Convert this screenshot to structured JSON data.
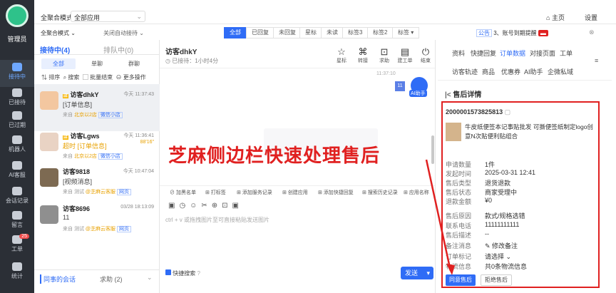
{
  "nav": {
    "user": "管理员",
    "items": [
      {
        "label": "接待中",
        "active": true
      },
      {
        "label": "已接待"
      },
      {
        "label": "已过期"
      },
      {
        "label": "机器人"
      },
      {
        "label": "AI客服"
      },
      {
        "label": "会话记录"
      },
      {
        "label": "留言"
      },
      {
        "label": "工单",
        "badge": "25"
      },
      {
        "label": "统计"
      }
    ]
  },
  "top": {
    "mode_label": "全聚合模式",
    "mode_value": "全部应用",
    "mode2": "全聚合模式",
    "auto": "关闭自动接待",
    "home": "主页",
    "settings": "设置",
    "filters": [
      "全部",
      "已回复",
      "未回复",
      "星标",
      "未读",
      "标签3",
      "标签2",
      "标签"
    ],
    "notice_tag": "公告",
    "notice": "3、账号到期提醒"
  },
  "list": {
    "tab_active": "接待中(4)",
    "tab_other": "排队中(0)",
    "subtabs": [
      "全部",
      "单聊",
      "群聊"
    ],
    "actions": [
      "排序",
      "搜索",
      "批量结束",
      "更多操作"
    ],
    "conversations": [
      {
        "name": "访客dhkY",
        "time": "今天 11:37:43",
        "msg": "[订单信息]",
        "src": "来自",
        "src_tag": "北京以2店",
        "app": "微信小店"
      },
      {
        "name": "访客Lgws",
        "time": "今天 11:36:41",
        "msg": "超时 [订单信息]",
        "src": "来自",
        "src_tag": "北京以2店",
        "app": "微信小店",
        "extra": "88'16\""
      },
      {
        "name": "访客9818",
        "time": "今天 10:47:04",
        "msg": "[视频消息]",
        "src": "来自 测试",
        "src_tag": "@芝麻云客服",
        "app": "网页"
      },
      {
        "name": "访客8696",
        "time": "03/28 18:13:09",
        "msg": "11",
        "src": "来自 测试",
        "src_tag": "@芝麻云客服",
        "app": "网页"
      }
    ],
    "footer_tab": "同事的会话",
    "footer_help": "求助 (2)"
  },
  "chat": {
    "title": "访客dhkY",
    "status": "已接待：1小时4分",
    "tools": [
      "星标",
      "转接",
      "求助",
      "建工单",
      "结束"
    ],
    "time_marker": "11:37:10",
    "ai_label": "AI助手",
    "bottom_tools": [
      "加黑名单",
      "打标签",
      "添加服务记录",
      "创建应用",
      "添加快捷回复",
      "搜索历史记录",
      "应用名称"
    ],
    "input_placeholder": "ctrl + v 或拖拽图片至可直接粘贴发送图片",
    "quick_search": "快捷搜索",
    "send": "发送"
  },
  "right": {
    "tabs_row1": [
      "资料",
      "快捷回复",
      "订单数据",
      "对接页面",
      "工单"
    ],
    "tabs_row2": [
      "访客轨迹",
      "商品",
      "优惠券",
      "AI助手",
      "企微私域"
    ],
    "section_title": "售后详情",
    "order_no": "2000001573825813",
    "product": "牛皮纸便签本记事贴批发 可撕便签纸制定logo创意N次贴便利贴组合",
    "fields": [
      {
        "label": "申请数量",
        "value": "1件"
      },
      {
        "label": "发起时间",
        "value": "2025-03-31 12:41"
      },
      {
        "label": "售后类型",
        "value": "退货退款"
      },
      {
        "label": "售后状态",
        "value": "商家受理中"
      },
      {
        "label": "退款金额",
        "value": "¥0"
      },
      {
        "label": "售后原因",
        "value": "款式/规格选错"
      },
      {
        "label": "联系电话",
        "value": "11111111111"
      },
      {
        "label": "售后描述",
        "value": "--"
      },
      {
        "label": "备注消息",
        "value": "修改备注"
      },
      {
        "label": "订单标记",
        "value": "请选择"
      },
      {
        "label": "物流信息",
        "value": "共0条物流信息"
      }
    ],
    "btn_agree": "同意售后",
    "btn_reject": "拒绝售后"
  },
  "overlay_caption": "芝麻侧边栏快速处理售后",
  "colors": {
    "accent": "#2f6cf6",
    "highlight": "#e02020",
    "nav": "#2b2f36"
  }
}
